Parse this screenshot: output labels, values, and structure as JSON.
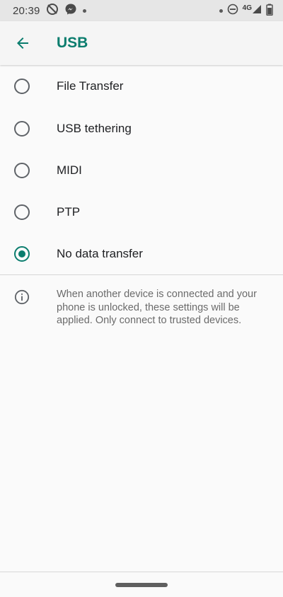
{
  "status_bar": {
    "time": "20:39",
    "network": "4G",
    "icons": [
      "data-saver-icon",
      "messenger-icon",
      "notification-dot-icon",
      "dnd-icon",
      "signal-icon",
      "battery-icon"
    ]
  },
  "app_bar": {
    "title": "USB",
    "back_icon": "arrow-back-icon"
  },
  "options": [
    {
      "label": "File Transfer",
      "selected": false
    },
    {
      "label": "USB tethering",
      "selected": false
    },
    {
      "label": "MIDI",
      "selected": false
    },
    {
      "label": "PTP",
      "selected": false
    },
    {
      "label": "No data transfer",
      "selected": true
    }
  ],
  "info": {
    "icon": "info-icon",
    "text": "When another device is connected and your phone is unlocked, these settings will be applied. Only connect to trusted devices."
  },
  "colors": {
    "accent": "#0b7d6e",
    "background": "#fafafa",
    "status_bar": "#e6e6e6",
    "secondary_text": "#6b6b6b"
  }
}
